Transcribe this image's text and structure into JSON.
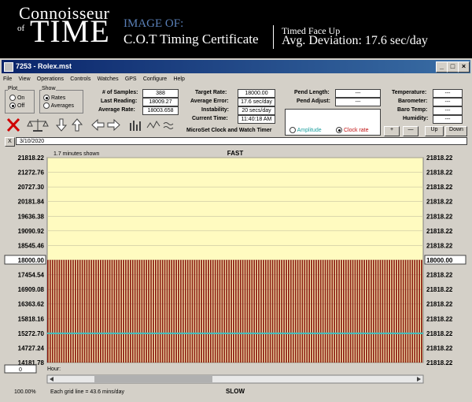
{
  "banner": {
    "logo_line1": "Connoisseur",
    "logo_of": "of",
    "logo_time": "TIME",
    "image_of": "IMAGE OF:",
    "cert_title": "C.O.T Timing Certificate",
    "position": "Timed Face Up",
    "avg_deviation": "Avg. Deviation: 17.6 sec/day"
  },
  "window": {
    "title": "7253 - Rolex.mst",
    "menu": [
      "File",
      "View",
      "Operations",
      "Controls",
      "Watches",
      "GPS",
      "Configure",
      "Help"
    ]
  },
  "plot_group": {
    "label": "Plot",
    "on": "On",
    "off": "Off",
    "selected": "Off"
  },
  "show_group": {
    "label": "Show",
    "rates": "Rates",
    "averages": "Averages",
    "selected": "Rates"
  },
  "stats": {
    "samples_label": "# of Samples:",
    "samples": "388",
    "last_label": "Last Reading:",
    "last": "18009.27",
    "avgrate_label": "Average Rate:",
    "avgrate": "18003.658"
  },
  "rates": {
    "target_label": "Target Rate:",
    "target": "18000.00",
    "avgerr_label": "Average Error:",
    "avgerr": "17.6 sec/day",
    "instab_label": "Instability:",
    "instab": "20 secs/day",
    "time_label": "Current Time:",
    "time": "11:40:18 AM",
    "microset": "MicroSet Clock and Watch Timer"
  },
  "pend": {
    "length_label": "Pend Length:",
    "length": "---",
    "adjust_label": "Pend Adjust:",
    "adjust": "---",
    "amplitude": "Amplitude",
    "clockrate": "Clock rate",
    "selected": "Clock rate"
  },
  "env": {
    "temp_label": "Temperature:",
    "temp": "---",
    "baro_label": "Barometer:",
    "baro": "---",
    "barotemp_label": "Baro Temp:",
    "barotemp": "---",
    "humid_label": "Humidity:",
    "humid": "---"
  },
  "buttons": {
    "plus": "+",
    "minus": "—",
    "up": "Up",
    "down": "Down",
    "close_x": "X"
  },
  "date": "3/10/2020",
  "chart_data": {
    "type": "bar",
    "title": "FAST",
    "bottom_label": "SLOW",
    "shown_label": "1.7 minutes shown",
    "hour_label": "Hour:",
    "zoom": "100.00%",
    "grid_note": "Each grid line = 43.6 mins/day",
    "scroll_value": "0",
    "left_ticks": [
      "21818.22",
      "21272.76",
      "20727.30",
      "20181.84",
      "19636.38",
      "19090.92",
      "18545.46",
      "18000.00",
      "17454.54",
      "16909.08",
      "16363.62",
      "15818.16",
      "15272.70",
      "14727.24",
      "14181.78"
    ],
    "right_ticks": [
      "21818.22",
      "21818.22",
      "21818.22",
      "21818.22",
      "21818.22",
      "21818.22",
      "21818.22",
      "18000.00",
      "21818.22",
      "21818.22",
      "21818.22",
      "21818.22",
      "21818.22",
      "21818.22",
      "21818.22"
    ],
    "target_label": "18000.00",
    "ylim": [
      14181.78,
      21818.22
    ],
    "bar_value": 18009.27,
    "bar_count": 164,
    "avg_line_value": 15272.7,
    "colors": {
      "bg": "#fffbc0",
      "bar": "#8b1a10",
      "avg_line": "#40c0c0"
    }
  }
}
